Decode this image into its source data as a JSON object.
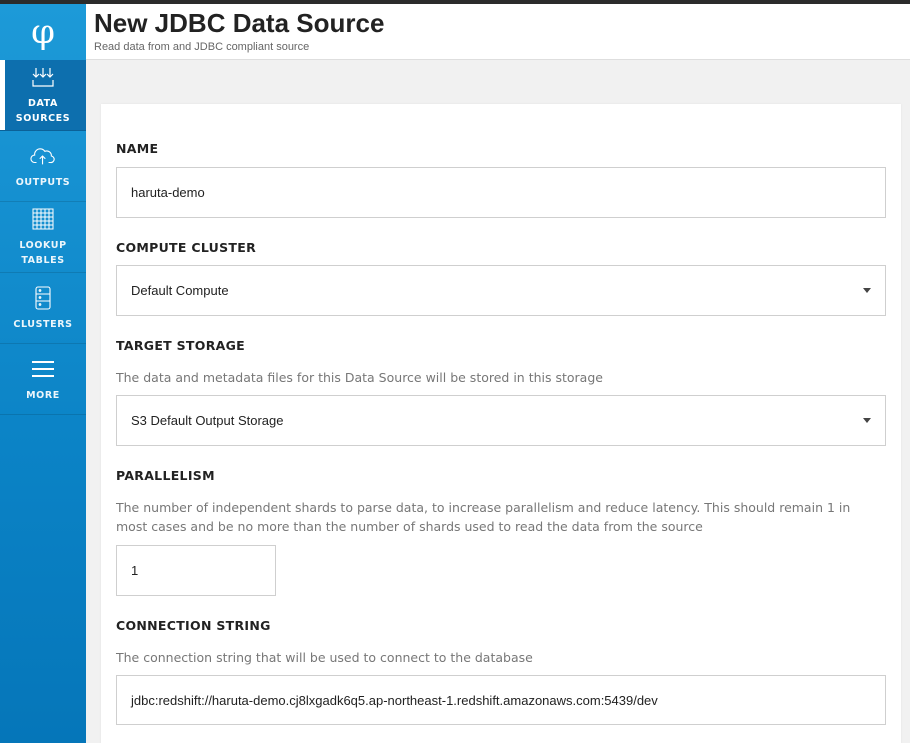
{
  "app": {
    "logo_glyph": "φ"
  },
  "sidebar": {
    "items": [
      {
        "label": "DATA\nSOURCES",
        "icon": "data-sources-icon",
        "active": true
      },
      {
        "label": "OUTPUTS",
        "icon": "cloud-upload-icon",
        "active": false
      },
      {
        "label": "LOOKUP\nTABLES",
        "icon": "grid-table-icon",
        "active": false
      },
      {
        "label": "CLUSTERS",
        "icon": "server-stack-icon",
        "active": false
      },
      {
        "label": "MORE",
        "icon": "hamburger-menu-icon",
        "active": false
      }
    ]
  },
  "header": {
    "title": "New JDBC Data Source",
    "subtitle": "Read data from and JDBC compliant source"
  },
  "form": {
    "name": {
      "label": "NAME",
      "value": "haruta-demo"
    },
    "compute_cluster": {
      "label": "COMPUTE CLUSTER",
      "value": "Default Compute"
    },
    "target_storage": {
      "label": "TARGET STORAGE",
      "description": "The data and metadata files for this Data Source will be stored in this storage",
      "value": "S3 Default Output Storage"
    },
    "parallelism": {
      "label": "PARALLELISM",
      "description": "The number of independent shards to parse data, to increase parallelism and reduce latency. This should remain 1 in most cases and be no more than the number of shards used to read the data from the source",
      "value": "1"
    },
    "connection_string": {
      "label": "CONNECTION STRING",
      "description": "The connection string that will be used to connect to the database",
      "value": "jdbc:redshift://haruta-demo.cj8lxgadk6q5.ap-northeast-1.redshift.amazonaws.com:5439/dev"
    }
  },
  "colors": {
    "sidebar_top": "#1d9ad8",
    "sidebar_bottom": "#0576b9",
    "active_item": "#0d6fae"
  }
}
